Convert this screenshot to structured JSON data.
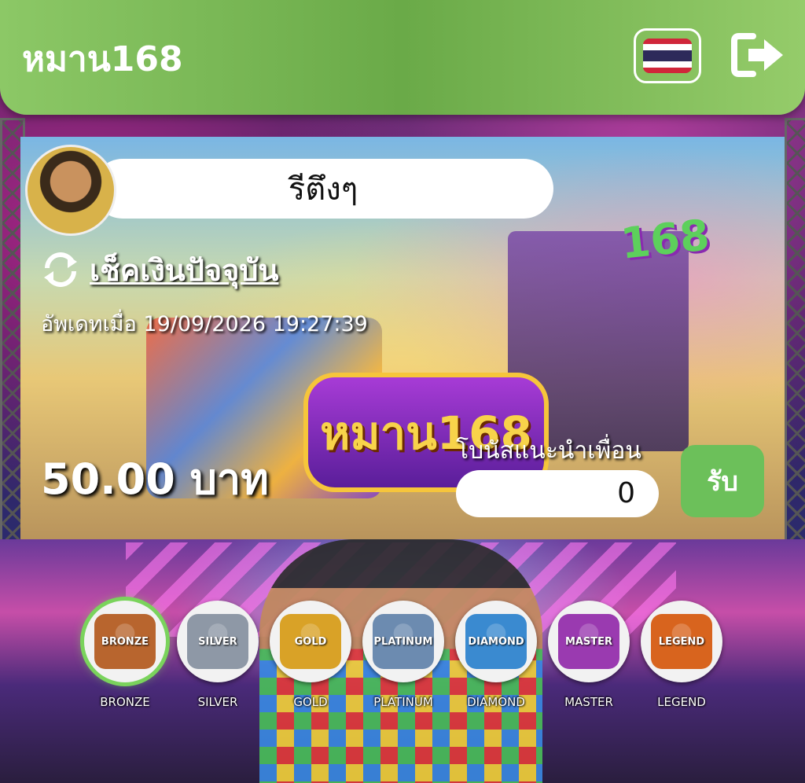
{
  "header": {
    "brand": "หมาน168",
    "language_flag": "thailand-flag",
    "logout_icon": "logout-icon"
  },
  "banner": {
    "username": "รีตึงๆ",
    "refresh_label": "เช็คเงินปัจจุบัน",
    "updated_text": "อัพเดทเมื่อ 19/09/2026 19:27:39",
    "balance": "50.00 บาท",
    "bonus_label": "โบนัสแนะนำเพื่อน",
    "bonus_value": "0",
    "claim_label": "รับ",
    "logo_text": "หมาน168"
  },
  "tiers": [
    {
      "label": "BRONZE",
      "emblem": "BRONZE",
      "color": "#b8652e",
      "active": true
    },
    {
      "label": "SILVER",
      "emblem": "SILVER",
      "color": "#8e98a6",
      "active": false
    },
    {
      "label": "GOLD",
      "emblem": "GOLD",
      "color": "#d9a227",
      "active": false
    },
    {
      "label": "PLATINUM",
      "emblem": "PLATINUM",
      "color": "#6c8bb0",
      "active": false
    },
    {
      "label": "DIAMOND",
      "emblem": "DIAMOND",
      "color": "#3a8ad0",
      "active": false
    },
    {
      "label": "MASTER",
      "emblem": "MASTER",
      "color": "#9a3ab0",
      "active": false
    },
    {
      "label": "LEGEND",
      "emblem": "LEGEND",
      "color": "#d8641e",
      "active": false
    }
  ],
  "colors": {
    "header_green": "#8cc866",
    "claim_green": "#6cc05a",
    "active_ring": "#7ad35c"
  }
}
